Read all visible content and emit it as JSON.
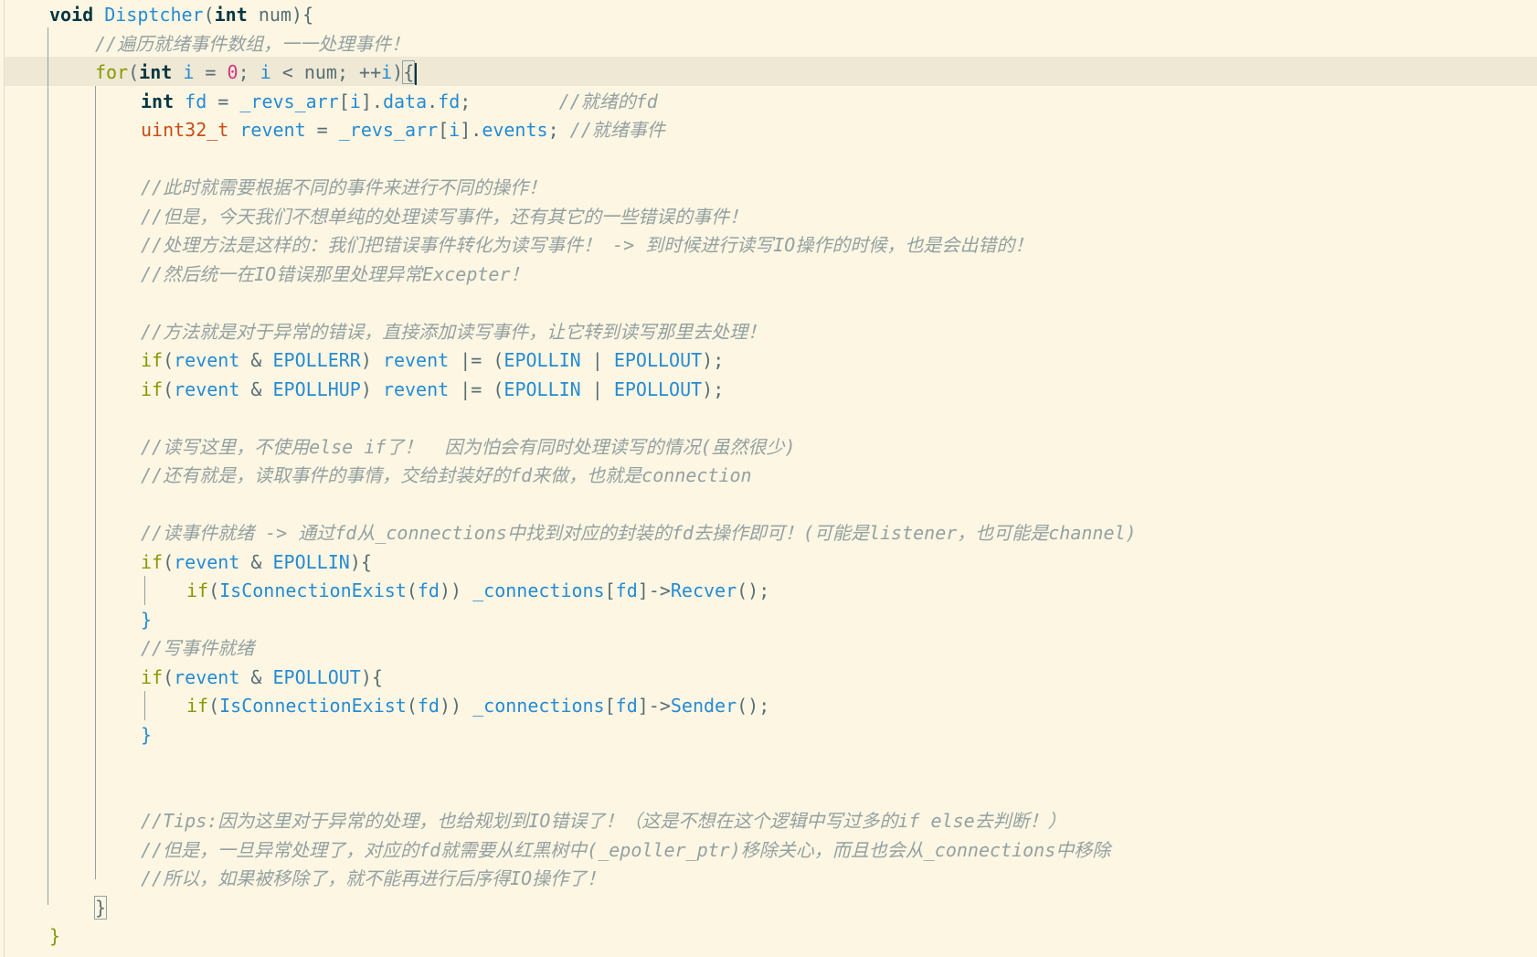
{
  "editor": {
    "lines": [
      {
        "indent": 0,
        "tokens": [
          [
            "kw",
            "void "
          ],
          [
            "fn",
            "Disptcher"
          ],
          [
            "punc",
            "("
          ],
          [
            "kw",
            "int "
          ],
          [
            "punc",
            "num){"
          ]
        ]
      },
      {
        "indent": 1,
        "tokens": [
          [
            "cm",
            "//遍历就绪事件数组，一一处理事件！"
          ]
        ]
      },
      {
        "indent": 1,
        "tokens": [
          [
            "ctl",
            "for"
          ],
          [
            "punc",
            "("
          ],
          [
            "kw",
            "int "
          ],
          [
            "var",
            "i"
          ],
          [
            "punc",
            " = "
          ],
          [
            "num",
            "0"
          ],
          [
            "punc",
            "; "
          ],
          [
            "var",
            "i"
          ],
          [
            "punc",
            " < num; ++"
          ],
          [
            "var",
            "i"
          ],
          [
            "punc",
            ")"
          ],
          [
            "hl",
            "{"
          ]
        ]
      },
      {
        "indent": 2,
        "tokens": [
          [
            "kw",
            "int "
          ],
          [
            "var",
            "fd"
          ],
          [
            "punc",
            " = "
          ],
          [
            "var",
            "_revs_arr"
          ],
          [
            "punc",
            "["
          ],
          [
            "var",
            "i"
          ],
          [
            "punc",
            "]."
          ],
          [
            "var",
            "data"
          ],
          [
            "punc",
            "."
          ],
          [
            "var",
            "fd"
          ],
          [
            "punc",
            ";        "
          ],
          [
            "cm",
            "//就绪的fd"
          ]
        ]
      },
      {
        "indent": 2,
        "tokens": [
          [
            "type",
            "uint32_t "
          ],
          [
            "var",
            "revent"
          ],
          [
            "punc",
            " = "
          ],
          [
            "var",
            "_revs_arr"
          ],
          [
            "punc",
            "["
          ],
          [
            "var",
            "i"
          ],
          [
            "punc",
            "]."
          ],
          [
            "var",
            "events"
          ],
          [
            "punc",
            "; "
          ],
          [
            "cm",
            "//就绪事件"
          ]
        ]
      },
      {
        "indent": 2,
        "tokens": []
      },
      {
        "indent": 2,
        "tokens": [
          [
            "cm",
            "//此时就需要根据不同的事件来进行不同的操作！"
          ]
        ]
      },
      {
        "indent": 2,
        "tokens": [
          [
            "cm",
            "//但是，今天我们不想单纯的处理读写事件，还有其它的一些错误的事件！"
          ]
        ]
      },
      {
        "indent": 2,
        "tokens": [
          [
            "cm",
            "//处理方法是这样的：我们把错误事件转化为读写事件！ -> 到时候进行读写IO操作的时候，也是会出错的！"
          ]
        ]
      },
      {
        "indent": 2,
        "tokens": [
          [
            "cm",
            "//然后统一在IO错误那里处理异常Excepter！"
          ]
        ]
      },
      {
        "indent": 2,
        "tokens": []
      },
      {
        "indent": 2,
        "tokens": [
          [
            "cm",
            "//方法就是对于异常的错误，直接添加读写事件，让它转到读写那里去处理！"
          ]
        ]
      },
      {
        "indent": 2,
        "tokens": [
          [
            "ctl",
            "if"
          ],
          [
            "punc",
            "("
          ],
          [
            "var",
            "revent"
          ],
          [
            "punc",
            " & "
          ],
          [
            "var",
            "EPOLLERR"
          ],
          [
            "punc",
            ") "
          ],
          [
            "var",
            "revent"
          ],
          [
            "punc",
            " |= ("
          ],
          [
            "var",
            "EPOLLIN"
          ],
          [
            "punc",
            " | "
          ],
          [
            "var",
            "EPOLLOUT"
          ],
          [
            "punc",
            ");"
          ]
        ]
      },
      {
        "indent": 2,
        "tokens": [
          [
            "ctl",
            "if"
          ],
          [
            "punc",
            "("
          ],
          [
            "var",
            "revent"
          ],
          [
            "punc",
            " & "
          ],
          [
            "var",
            "EPOLLHUP"
          ],
          [
            "punc",
            ") "
          ],
          [
            "var",
            "revent"
          ],
          [
            "punc",
            " |= ("
          ],
          [
            "var",
            "EPOLLIN"
          ],
          [
            "punc",
            " | "
          ],
          [
            "var",
            "EPOLLOUT"
          ],
          [
            "punc",
            ");"
          ]
        ]
      },
      {
        "indent": 2,
        "tokens": []
      },
      {
        "indent": 2,
        "tokens": [
          [
            "cm",
            "//读写这里，不使用else if了！  因为怕会有同时处理读写的情况(虽然很少)"
          ]
        ]
      },
      {
        "indent": 2,
        "tokens": [
          [
            "cm",
            "//还有就是，读取事件的事情，交给封装好的fd来做，也就是connection"
          ]
        ]
      },
      {
        "indent": 2,
        "tokens": []
      },
      {
        "indent": 2,
        "tokens": [
          [
            "cm",
            "//读事件就绪 -> 通过fd从_connections中找到对应的封装的fd去操作即可！(可能是listener，也可能是channel)"
          ]
        ]
      },
      {
        "indent": 2,
        "tokens": [
          [
            "ctl",
            "if"
          ],
          [
            "punc",
            "("
          ],
          [
            "var",
            "revent"
          ],
          [
            "punc",
            " & "
          ],
          [
            "var",
            "EPOLLIN"
          ],
          [
            "punc",
            "){"
          ]
        ]
      },
      {
        "indent": 3,
        "tokens": [
          [
            "ctl",
            "if"
          ],
          [
            "punc",
            "("
          ],
          [
            "fn",
            "IsConnectionExist"
          ],
          [
            "punc",
            "("
          ],
          [
            "var",
            "fd"
          ],
          [
            "punc",
            ")) "
          ],
          [
            "var",
            "_connections"
          ],
          [
            "punc",
            "["
          ],
          [
            "var",
            "fd"
          ],
          [
            "punc",
            "]->"
          ],
          [
            "fn",
            "Recver"
          ],
          [
            "punc",
            "();"
          ]
        ]
      },
      {
        "indent": 2,
        "tokens": [
          [
            "br",
            "}"
          ]
        ]
      },
      {
        "indent": 2,
        "tokens": [
          [
            "cm",
            "//写事件就绪"
          ]
        ]
      },
      {
        "indent": 2,
        "tokens": [
          [
            "ctl",
            "if"
          ],
          [
            "punc",
            "("
          ],
          [
            "var",
            "revent"
          ],
          [
            "punc",
            " & "
          ],
          [
            "var",
            "EPOLLOUT"
          ],
          [
            "punc",
            "){"
          ]
        ]
      },
      {
        "indent": 3,
        "tokens": [
          [
            "ctl",
            "if"
          ],
          [
            "punc",
            "("
          ],
          [
            "fn",
            "IsConnectionExist"
          ],
          [
            "punc",
            "("
          ],
          [
            "var",
            "fd"
          ],
          [
            "punc",
            ")) "
          ],
          [
            "var",
            "_connections"
          ],
          [
            "punc",
            "["
          ],
          [
            "var",
            "fd"
          ],
          [
            "punc",
            "]->"
          ],
          [
            "fn",
            "Sender"
          ],
          [
            "punc",
            "();"
          ]
        ]
      },
      {
        "indent": 2,
        "tokens": [
          [
            "br",
            "}"
          ]
        ]
      },
      {
        "indent": 2,
        "tokens": []
      },
      {
        "indent": 2,
        "tokens": []
      },
      {
        "indent": 2,
        "tokens": [
          [
            "cm",
            "//Tips:因为这里对于异常的处理，也给规划到IO错误了！（这是不想在这个逻辑中写过多的if else去判断！）"
          ]
        ]
      },
      {
        "indent": 2,
        "tokens": [
          [
            "cm",
            "//但是，一旦异常处理了，对应的fd就需要从红黑树中(_epoller_ptr)移除关心，而且也会从_connections中移除"
          ]
        ]
      },
      {
        "indent": 2,
        "tokens": [
          [
            "cm",
            "//所以，如果被移除了，就不能再进行后序得IO操作了！"
          ]
        ]
      },
      {
        "indent": 1,
        "tokens": [
          [
            "hl",
            "}"
          ]
        ]
      },
      {
        "indent": 0,
        "tokens": [
          [
            "ctl",
            "}"
          ]
        ]
      }
    ]
  }
}
